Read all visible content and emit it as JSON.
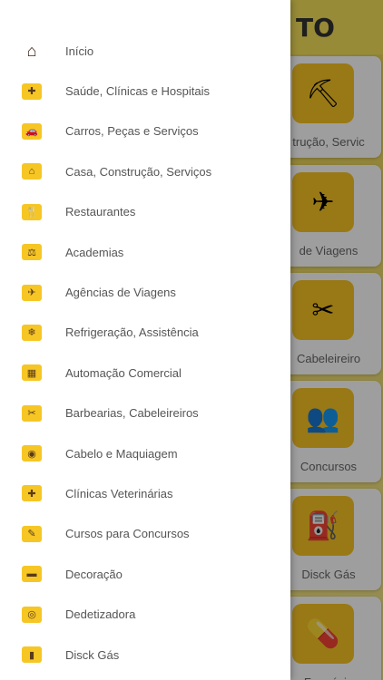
{
  "background": {
    "title": "TO",
    "cards": [
      {
        "caption": "trução, Servic",
        "icon": "construction-icon",
        "glyph": "⛏"
      },
      {
        "caption": "de Viagens",
        "icon": "airplane-icon",
        "glyph": "✈"
      },
      {
        "caption": "Cabeleireiro",
        "icon": "barber-icon",
        "glyph": "✂"
      },
      {
        "caption": "Concursos",
        "icon": "people-icon",
        "glyph": "👥"
      },
      {
        "caption": "Disck Gás",
        "icon": "gas-cylinder-icon",
        "glyph": "⛽"
      },
      {
        "caption": "Farmácia",
        "icon": "pills-icon",
        "glyph": "💊"
      }
    ]
  },
  "drawer": {
    "items": [
      {
        "label": "Início",
        "icon": "home-icon",
        "glyph": "⌂"
      },
      {
        "label": "Saúde, Clínicas e Hospitais",
        "icon": "health-icon",
        "glyph": "✚"
      },
      {
        "label": "Carros, Peças e Serviços",
        "icon": "car-icon",
        "glyph": "🚗"
      },
      {
        "label": "Casa, Construção, Serviços",
        "icon": "house-construction-icon",
        "glyph": "⌂"
      },
      {
        "label": "Restaurantes",
        "icon": "restaurant-icon",
        "glyph": "🍴"
      },
      {
        "label": "Academias",
        "icon": "dumbbell-icon",
        "glyph": "⚖"
      },
      {
        "label": "Agências de Viagens",
        "icon": "travel-icon",
        "glyph": "✈"
      },
      {
        "label": "Refrigeração, Assistência",
        "icon": "refrigeration-icon",
        "glyph": "❄"
      },
      {
        "label": "Automação Comercial",
        "icon": "register-icon",
        "glyph": "▦"
      },
      {
        "label": "Barbearias, Cabeleireiros",
        "icon": "barber-icon",
        "glyph": "✂"
      },
      {
        "label": "Cabelo e Maquiagem",
        "icon": "makeup-icon",
        "glyph": "◉"
      },
      {
        "label": "Clínicas Veterinárias",
        "icon": "veterinary-icon",
        "glyph": "✚"
      },
      {
        "label": "Cursos para Concursos",
        "icon": "course-icon",
        "glyph": "✎"
      },
      {
        "label": "Decoração",
        "icon": "sofa-icon",
        "glyph": "▬"
      },
      {
        "label": "Dedetizadora",
        "icon": "pest-control-icon",
        "glyph": "◎"
      },
      {
        "label": "Disck Gás",
        "icon": "gas-cylinder-icon",
        "glyph": "▮"
      }
    ]
  }
}
